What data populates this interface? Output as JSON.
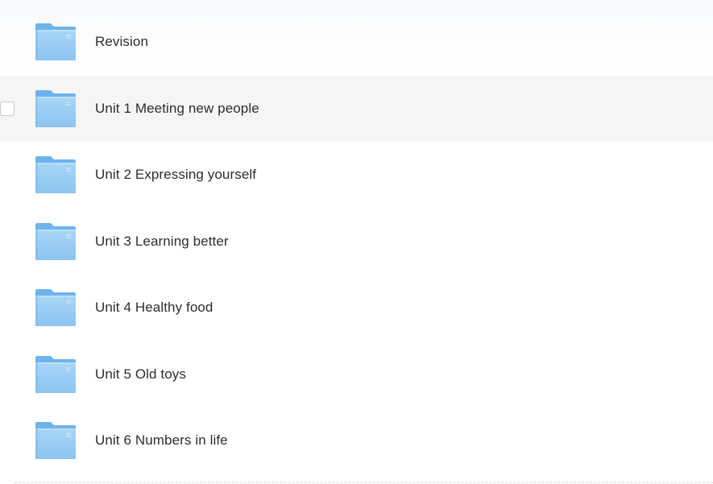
{
  "folders": [
    {
      "name": "Revision",
      "icon": "folder-icon"
    },
    {
      "name": "Unit 1 Meeting new people",
      "icon": "folder-icon"
    },
    {
      "name": "Unit 2 Expressing yourself",
      "icon": "folder-icon"
    },
    {
      "name": "Unit 3 Learning better",
      "icon": "folder-icon"
    },
    {
      "name": "Unit 4 Healthy food",
      "icon": "folder-icon"
    },
    {
      "name": "Unit 5 Old toys",
      "icon": "folder-icon"
    },
    {
      "name": "Unit 6 Numbers in life",
      "icon": "folder-icon"
    }
  ],
  "hovered_row": 1,
  "colors": {
    "folder_body": "#9fd0f5",
    "folder_back": "#6fb3ec",
    "row_hover": "#f5f5f5",
    "text": "#2d2d2d"
  }
}
